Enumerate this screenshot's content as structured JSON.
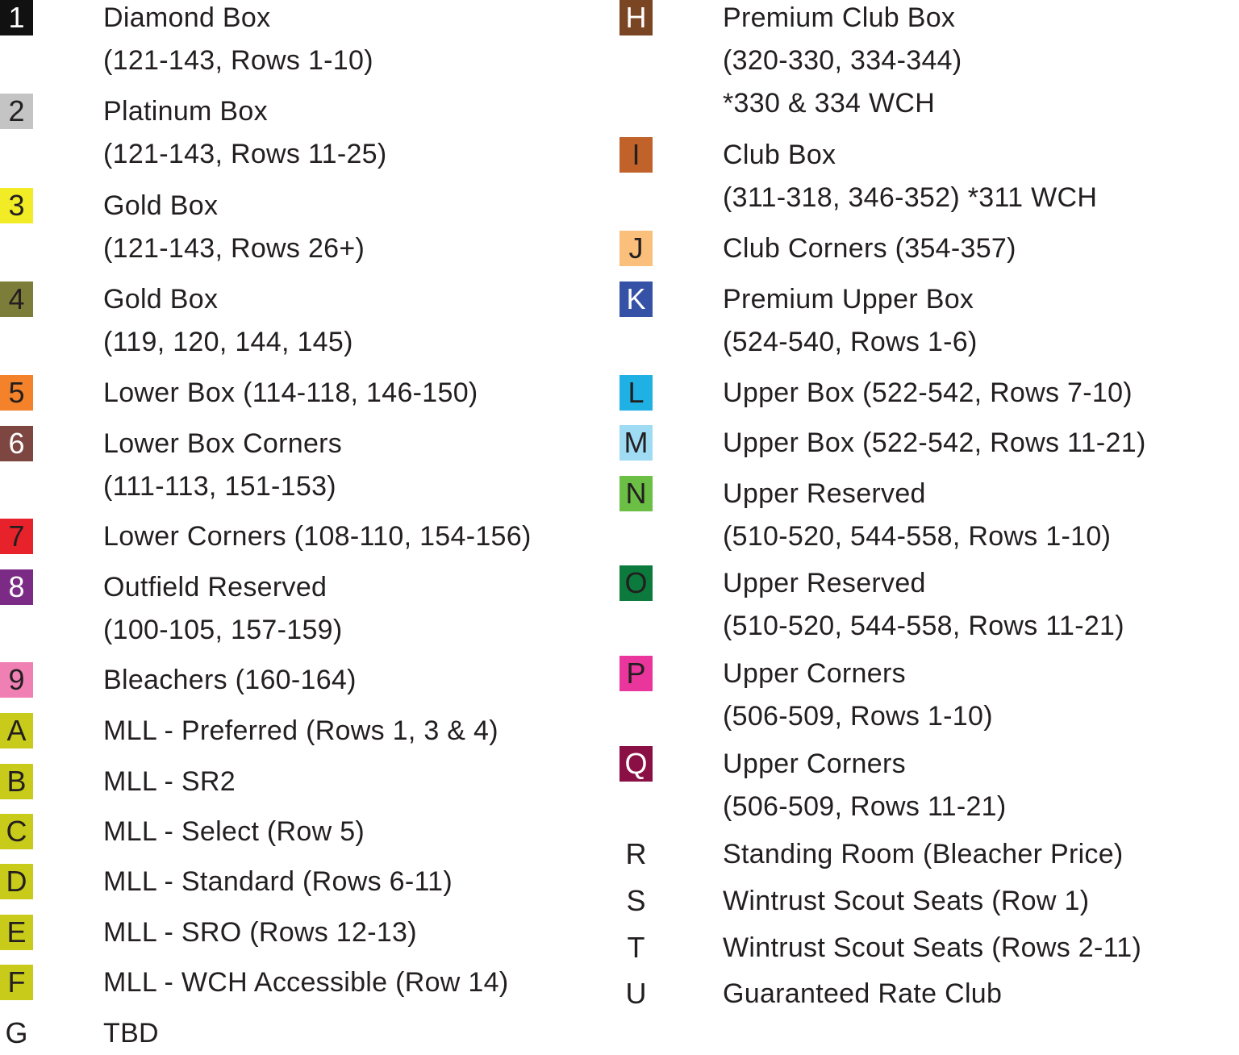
{
  "legend": {
    "left_column": [
      {
        "code": "1",
        "color": "#111111",
        "code_color": "#ffffff",
        "lines": [
          "Diamond Box",
          "(121-143, Rows 1-10)"
        ]
      },
      {
        "code": "2",
        "color": "#c4c4c4",
        "code_color": "#231f20",
        "lines": [
          "Platinum Box",
          "(121-143, Rows 11-25)"
        ]
      },
      {
        "code": "3",
        "color": "#f2ec26",
        "code_color": "#231f20",
        "lines": [
          "Gold Box",
          "(121-143, Rows 26+)"
        ]
      },
      {
        "code": "4",
        "color": "#7d7d3a",
        "code_color": "#231f20",
        "lines": [
          "Gold Box",
          "(119, 120, 144, 145)"
        ]
      },
      {
        "code": "5",
        "color": "#f4822a",
        "code_color": "#231f20",
        "lines": [
          "Lower Box (114-118, 146-150)"
        ]
      },
      {
        "code": "6",
        "color": "#7e4640",
        "code_color": "#ffffff",
        "lines": [
          "Lower Box Corners",
          "(111-113, 151-153)"
        ]
      },
      {
        "code": "7",
        "color": "#e8222a",
        "code_color": "#231f20",
        "lines": [
          "Lower Corners (108-110, 154-156)"
        ]
      },
      {
        "code": "8",
        "color": "#7b2a86",
        "code_color": "#ffffff",
        "lines": [
          "Outfield Reserved",
          "(100-105, 157-159)"
        ]
      },
      {
        "code": "9",
        "color": "#f080b4",
        "code_color": "#231f20",
        "lines": [
          "Bleachers (160-164)"
        ]
      },
      {
        "code": "A",
        "color": "#c8cb1a",
        "code_color": "#231f20",
        "lines": [
          "MLL - Preferred (Rows 1, 3 & 4)"
        ]
      },
      {
        "code": "B",
        "color": "#c8cb1a",
        "code_color": "#231f20",
        "lines": [
          "MLL - SR2"
        ]
      },
      {
        "code": "C",
        "color": "#c8cb1a",
        "code_color": "#231f20",
        "lines": [
          "MLL - Select (Row 5)"
        ]
      },
      {
        "code": "D",
        "color": "#c8cb1a",
        "code_color": "#231f20",
        "lines": [
          "MLL - Standard (Rows 6-11)"
        ]
      },
      {
        "code": "E",
        "color": "#c8cb1a",
        "code_color": "#231f20",
        "lines": [
          "MLL - SRO (Rows 12-13)"
        ]
      },
      {
        "code": "F",
        "color": "#c8cb1a",
        "code_color": "#231f20",
        "lines": [
          "MLL - WCH Accessible (Row 14)"
        ]
      },
      {
        "code": "G",
        "color": null,
        "code_color": "#231f20",
        "lines": [
          "TBD"
        ]
      }
    ],
    "right_column": [
      {
        "code": "H",
        "color": "#7a4522",
        "code_color": "#ffffff",
        "lines": [
          "Premium Club Box",
          "(320-330, 334-344)",
          "*330 & 334 WCH"
        ]
      },
      {
        "code": "I",
        "color": "#c0622a",
        "code_color": "#231f20",
        "lines": [
          "Club Box",
          "(311-318, 346-352) *311 WCH"
        ]
      },
      {
        "code": "J",
        "color": "#fbbf7c",
        "code_color": "#231f20",
        "lines": [
          "Club Corners (354-357)"
        ]
      },
      {
        "code": "K",
        "color": "#3552a6",
        "code_color": "#ffffff",
        "lines": [
          "Premium Upper Box",
          "(524-540, Rows 1-6)"
        ]
      },
      {
        "code": "L",
        "color": "#1fb1e3",
        "code_color": "#231f20",
        "lines": [
          "Upper Box (522-542, Rows 7-10)"
        ]
      },
      {
        "code": "M",
        "color": "#9fdcf3",
        "code_color": "#231f20",
        "lines": [
          "Upper Box (522-542, Rows 11-21)"
        ]
      },
      {
        "code": "N",
        "color": "#6cbf45",
        "code_color": "#231f20",
        "lines": [
          "Upper Reserved",
          "(510-520, 544-558, Rows 1-10)"
        ]
      },
      {
        "code": "O",
        "color": "#0b7a3c",
        "code_color": "#231f20",
        "lines": [
          "Upper Reserved",
          "(510-520, 544-558, Rows 11-21)"
        ]
      },
      {
        "code": "P",
        "color": "#e9359c",
        "code_color": "#231f20",
        "lines": [
          "Upper Corners",
          "(506-509, Rows 1-10)"
        ]
      },
      {
        "code": "Q",
        "color": "#8a0f45",
        "code_color": "#ffffff",
        "lines": [
          "Upper Corners",
          "(506-509, Rows 11-21)"
        ]
      },
      {
        "code": "R",
        "color": null,
        "code_color": "#231f20",
        "lines": [
          "Standing Room (Bleacher Price)"
        ]
      },
      {
        "code": "S",
        "color": null,
        "code_color": "#231f20",
        "lines": [
          "Wintrust Scout Seats (Row 1)"
        ]
      },
      {
        "code": "T",
        "color": null,
        "code_color": "#231f20",
        "lines": [
          "Wintrust Scout Seats (Rows 2-11)"
        ]
      },
      {
        "code": "U",
        "color": null,
        "code_color": "#231f20",
        "lines": [
          "Guaranteed Rate Club"
        ]
      }
    ]
  }
}
